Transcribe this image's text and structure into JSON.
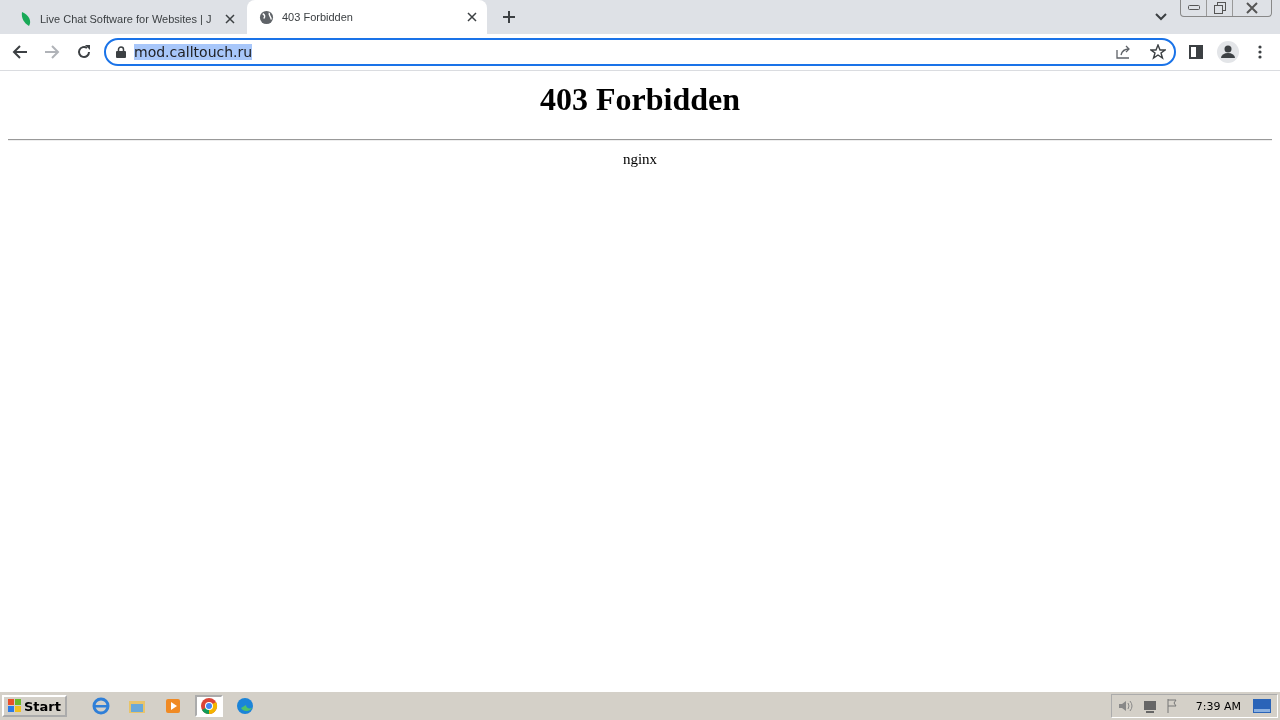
{
  "tabs": [
    {
      "title": "Live Chat Software for Websites | J",
      "kind": "leaf",
      "selected": false
    },
    {
      "title": "403 Forbidden",
      "kind": "globe",
      "selected": true
    }
  ],
  "address_bar": {
    "url": "mod.calltouch.ru",
    "highlighted": true
  },
  "page": {
    "heading": "403 Forbidden",
    "footer": "nginx"
  },
  "taskbar": {
    "start": "Start",
    "apps": [
      {
        "kind": "ie",
        "selected": false
      },
      {
        "kind": "folder",
        "selected": false
      },
      {
        "kind": "media",
        "selected": false
      },
      {
        "kind": "chrome",
        "selected": true
      },
      {
        "kind": "edge",
        "selected": false
      }
    ],
    "time": "7:39 AM"
  }
}
